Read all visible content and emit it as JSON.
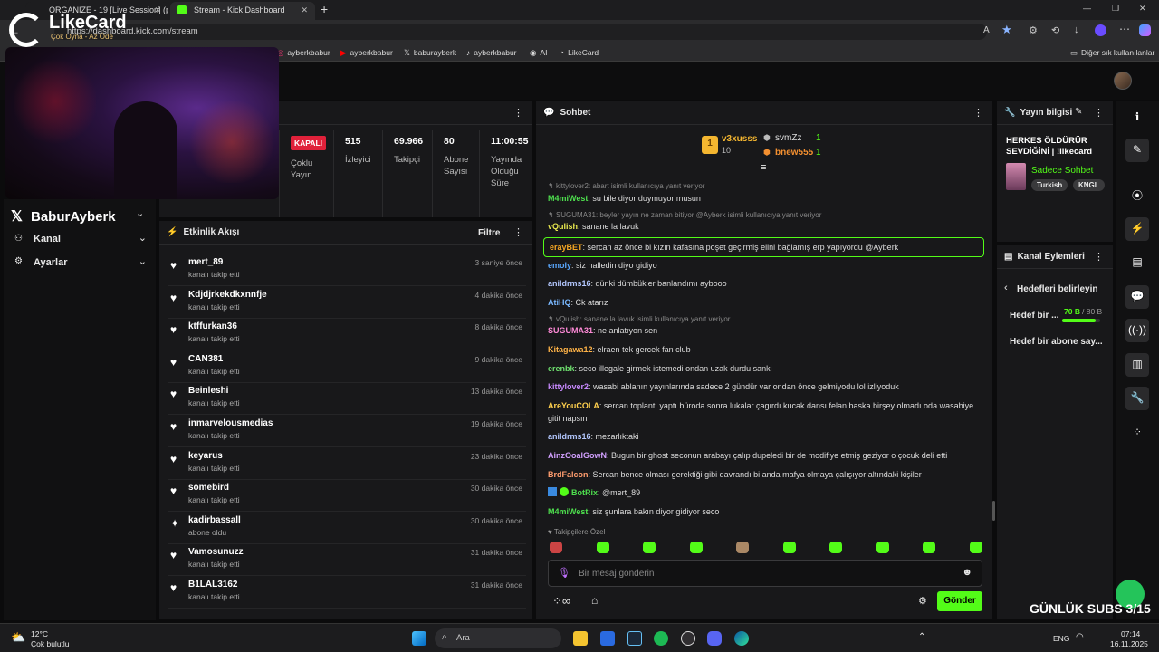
{
  "browser": {
    "tabs": [
      {
        "title": "ORGANIZE - 19 [Live Session] (pr"
      },
      {
        "title": "Stream - Kick Dashboard"
      }
    ],
    "new_tab": "+",
    "url": "https://dashboard.kick.com/stream",
    "bookmarks": [
      "ayberkbabur",
      "ayberkbabur",
      "baburayberk",
      "ayberkbabur",
      "AI",
      "LikeCard"
    ],
    "other_bookmarks": "Diğer sık kullanılanlar",
    "window_controls": [
      "—",
      "❐",
      "✕"
    ]
  },
  "overlay": {
    "brand": "LikeCard",
    "brand_sub": "Çok Oyna - Az Öde",
    "streamer": "BaburAyberk",
    "subs_counter": "GÜNLÜK SUBS 3/15"
  },
  "sidebar": {
    "items": [
      {
        "label": "Kanal"
      },
      {
        "label": "Ayarlar"
      }
    ]
  },
  "stats": [
    {
      "value": "KAPALI",
      "label": "Çoklu Yayın"
    },
    {
      "value": "515",
      "label": "İzleyici"
    },
    {
      "value": "69.966",
      "label": "Takipçi"
    },
    {
      "value": "80",
      "label": "Abone Sayısı"
    },
    {
      "value": "11:00:55",
      "label": "Yayında Olduğu Süre"
    }
  ],
  "activity": {
    "title": "Etkinlik Akışı",
    "filter": "Filtre",
    "items": [
      {
        "name": "mert_89",
        "action": "kanalı takip etti",
        "time": "3 saniye önce"
      },
      {
        "name": "Kdjdjrkekdkxnnfje",
        "action": "kanalı takip etti",
        "time": "4 dakika önce"
      },
      {
        "name": "ktffurkan36",
        "action": "kanalı takip etti",
        "time": "8 dakika önce"
      },
      {
        "name": "CAN381",
        "action": "kanalı takip etti",
        "time": "9 dakika önce"
      },
      {
        "name": "Beinleshi",
        "action": "kanalı takip etti",
        "time": "13 dakika önce"
      },
      {
        "name": "inmarvelousmedias",
        "action": "kanalı takip etti",
        "time": "19 dakika önce"
      },
      {
        "name": "keyarus",
        "action": "kanalı takip etti",
        "time": "23 dakika önce"
      },
      {
        "name": "somebird",
        "action": "kanalı takip etti",
        "time": "30 dakika önce"
      },
      {
        "name": "kadirbassall",
        "action": "abone oldu",
        "time": "30 dakika önce"
      },
      {
        "name": "Vamosunuzz",
        "action": "kanalı takip etti",
        "time": "31 dakika önce"
      },
      {
        "name": "B1LAL3162",
        "action": "kanalı takip etti",
        "time": "31 dakika önce"
      }
    ]
  },
  "chat": {
    "title": "Sohbet",
    "top": [
      {
        "rank": "1",
        "name": "v3xusss",
        "count": "10"
      },
      {
        "name": "svmZz",
        "count": "1"
      },
      {
        "name": "bnew555",
        "count": "1"
      }
    ],
    "replies": [
      "kittylover2: abart isimli kullanıcıya yanıt veriyor",
      "SUGUMA31: beyler yayın ne zaman bitiyor @Ayberk isimli kullanıcıya yanıt veriyor",
      "vQulish: sanane la lavuk isimli kullanıcıya yanıt veriyor"
    ],
    "messages": [
      {
        "user": "M4miWest",
        "color": "#4ee04e",
        "text": "su bile diyor duymuyor musun"
      },
      {
        "user": "vQulish",
        "color": "#e8e84e",
        "text": "sanane la lavuk"
      },
      {
        "user": "erayBET",
        "color": "#f5a623",
        "text": "sercan az önce bi kızın kafasına poşet geçirmiş elini bağlamış erp yapıyordu @Ayberk"
      },
      {
        "user": "emoly",
        "color": "#5aa8ff",
        "text": "siz halledin diyo gidiyo"
      },
      {
        "user": "anildrms16",
        "color": "#b4c8ff",
        "text": "dünki dümbükler banlandımı aybooo"
      },
      {
        "user": "AtiHQ",
        "color": "#7ab8ff",
        "text": "Ck atarız"
      },
      {
        "user": "SUGUMA31",
        "color": "#ff8ad8",
        "text": "ne anlatıyon sen"
      },
      {
        "user": "Kitagawa12",
        "color": "#ffb347",
        "text": "elraen tek gercek fan club"
      },
      {
        "user": "erenbk",
        "color": "#6fe06f",
        "text": "seco illegale girmek istemedi ondan uzak durdu sanki"
      },
      {
        "user": "kittylover2",
        "color": "#c88aff",
        "text": "wasabi ablanın yayınlarında sadece 2 gündür var ondan önce gelmiyodu lol izliyoduk"
      },
      {
        "user": "AreYouCOLA",
        "color": "#ffd04e",
        "text": "sercan toplantı yaptı büroda sonra lukalar çagırdı kucak dansı felan baska birşey olmadı oda wasabiye gitit napsın"
      },
      {
        "user": "anildrms16",
        "color": "#b4c8ff",
        "text": "mezarlıktaki"
      },
      {
        "user": "AinzOoalGowN",
        "color": "#d2a0ff",
        "text": "Bugun bir ghost seconun arabayı çalıp dupeledi bir de modifiye etmiş geziyor o çocuk deli etti"
      },
      {
        "user": "BrdFalcon",
        "color": "#ff9d6e",
        "text": "Sercan bence olması gerektiği gibi davrandı bi anda mafya olmaya çalışıyor altındaki kişiler"
      },
      {
        "user": "BotRix",
        "color": "#4ee04e",
        "text": "@mert_89"
      },
      {
        "user": "M4miWest",
        "color": "#4ee04e",
        "text": "siz şunlara bakın diyor gidiyor seco"
      }
    ],
    "followers_only": "Takipçilere Özel",
    "input_placeholder": "Bir mesaj gönderin",
    "send": "Gönder"
  },
  "stream_info": {
    "title": "Yayın bilgisi",
    "stream_title": "HERKES ÖLDÜRÜR SEVDİĞİNİ | !likecard",
    "category": "Sadece Sohbet",
    "tags": [
      "Turkish",
      "KNGL"
    ]
  },
  "channel_actions": {
    "title": "Kanal Eylemleri",
    "goals_title": "Hedefleri belirleyin",
    "goal1": "Hedef bir ...",
    "goal1_current": "70 B",
    "goal1_target": "/ 80 B",
    "goal1_progress": 0.875,
    "goal2": "Hedef bir abone say..."
  },
  "taskbar": {
    "weather_temp": "12°C",
    "weather_desc": "Çok bulutlu",
    "search": "Ara",
    "lang": "ENG",
    "time": "07:14",
    "date": "16.11.2025"
  }
}
